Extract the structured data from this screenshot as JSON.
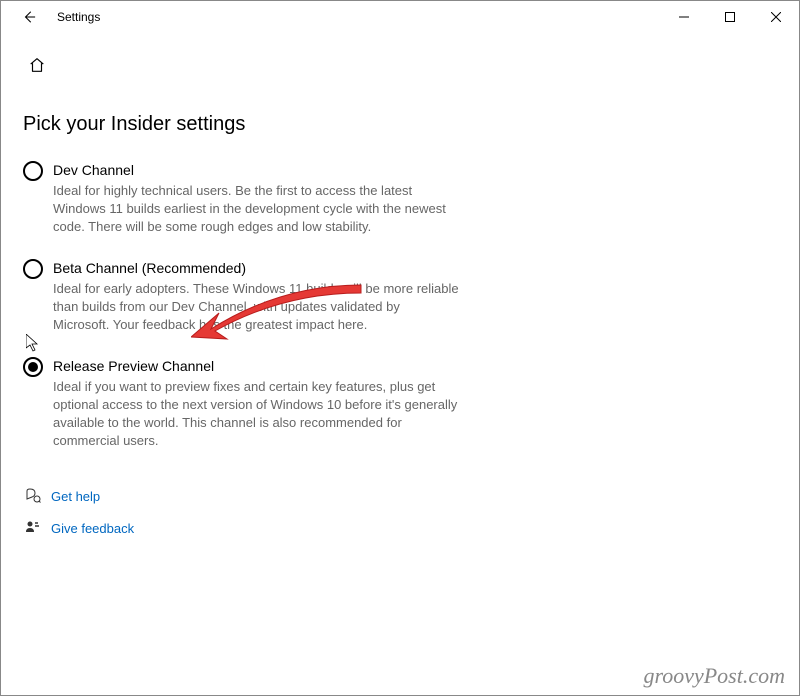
{
  "window": {
    "title": "Settings"
  },
  "page": {
    "heading": "Pick your Insider settings"
  },
  "options": [
    {
      "title": "Dev Channel",
      "desc": "Ideal for highly technical users. Be the first to access the latest Windows 11 builds earliest in the development cycle with the newest code. There will be some rough edges and low stability.",
      "selected": false
    },
    {
      "title": "Beta Channel (Recommended)",
      "desc": "Ideal for early adopters. These Windows 11 builds will be more reliable than builds from our Dev Channel, with updates validated by Microsoft. Your feedback has the greatest impact here.",
      "selected": false
    },
    {
      "title": "Release Preview Channel",
      "desc": "Ideal if you want to preview fixes and certain key features, plus get optional access to the next version of Windows 10 before it's generally available to the world. This channel is also recommended for commercial users.",
      "selected": true
    }
  ],
  "links": {
    "help": "Get help",
    "feedback": "Give feedback"
  },
  "watermark": "groovyPost.com",
  "annotation": {
    "arrow_color": "#e53935"
  }
}
